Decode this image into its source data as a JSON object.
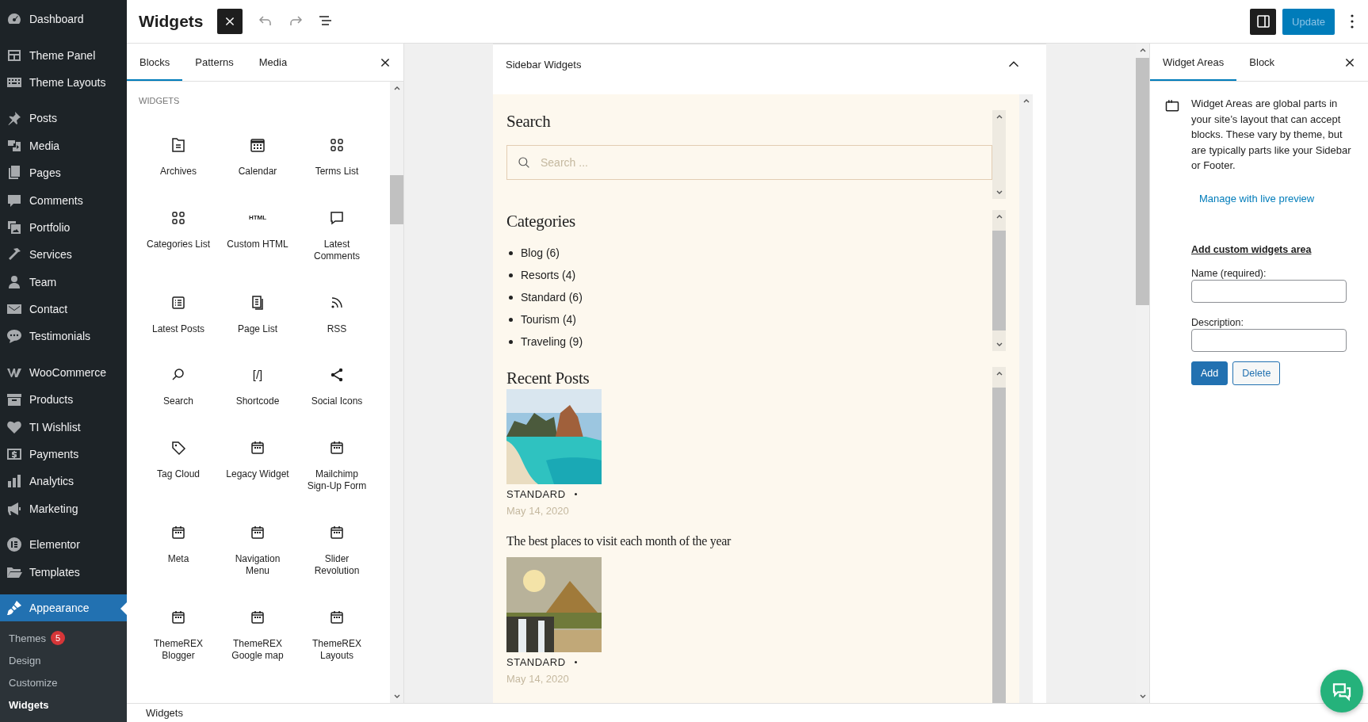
{
  "admin_menu": {
    "groups": [
      [
        {
          "label": "Dashboard",
          "kind": "dashboard",
          "selected": false
        }
      ],
      [
        {
          "label": "Theme Panel",
          "kind": "panel",
          "selected": false
        },
        {
          "label": "Theme Layouts",
          "kind": "layouts",
          "selected": false
        }
      ],
      [
        {
          "label": "Posts",
          "kind": "pin",
          "selected": false
        },
        {
          "label": "Media",
          "kind": "media",
          "selected": false
        },
        {
          "label": "Pages",
          "kind": "pages",
          "selected": false
        },
        {
          "label": "Comments",
          "kind": "comment",
          "selected": false
        },
        {
          "label": "Portfolio",
          "kind": "portfolio",
          "selected": false
        },
        {
          "label": "Services",
          "kind": "hammer",
          "selected": false
        },
        {
          "label": "Team",
          "kind": "person",
          "selected": false
        },
        {
          "label": "Contact",
          "kind": "mail",
          "selected": false
        },
        {
          "label": "Testimonials",
          "kind": "chat",
          "selected": false
        }
      ],
      [
        {
          "label": "WooCommerce",
          "kind": "woo",
          "selected": false
        },
        {
          "label": "Products",
          "kind": "box",
          "selected": false
        },
        {
          "label": "TI Wishlist",
          "kind": "heart",
          "selected": false
        },
        {
          "label": "Payments",
          "kind": "dollar",
          "selected": false
        },
        {
          "label": "Analytics",
          "kind": "bars",
          "selected": false
        },
        {
          "label": "Marketing",
          "kind": "megaphone",
          "selected": false
        }
      ],
      [
        {
          "label": "Elementor",
          "kind": "elementor",
          "selected": false
        },
        {
          "label": "Templates",
          "kind": "folder",
          "selected": false
        }
      ],
      [
        {
          "label": "Appearance",
          "kind": "brush",
          "selected": true
        }
      ]
    ],
    "submenu": [
      {
        "label": "Themes",
        "badge": "5",
        "selected": false
      },
      {
        "label": "Design",
        "selected": false
      },
      {
        "label": "Customize",
        "selected": false
      },
      {
        "label": "Widgets",
        "selected": true
      }
    ]
  },
  "header": {
    "title": "Widgets",
    "update": {
      "label": "Update",
      "disabled": true
    }
  },
  "inserter": {
    "tabs": [
      {
        "label": "Blocks",
        "selected": true
      },
      {
        "label": "Patterns",
        "selected": false
      },
      {
        "label": "Media",
        "selected": false
      }
    ],
    "section_title": "WIDGETS",
    "blocks": [
      {
        "label": "Archives",
        "kind": "archive"
      },
      {
        "label": "Calendar",
        "kind": "calendar"
      },
      {
        "label": "Terms List",
        "kind": "grid"
      },
      {
        "label": "Categories List",
        "kind": "grid"
      },
      {
        "label": "Custom HTML",
        "kind": "html",
        "icon_text": "HTML"
      },
      {
        "label": "Latest Comments",
        "kind": "comment"
      },
      {
        "label": "Latest Posts",
        "kind": "list"
      },
      {
        "label": "Page List",
        "kind": "pages"
      },
      {
        "label": "RSS",
        "kind": "rss"
      },
      {
        "label": "Search",
        "kind": "search"
      },
      {
        "label": "Shortcode",
        "kind": "shortcode",
        "icon_text": "[/]"
      },
      {
        "label": "Social Icons",
        "kind": "share"
      },
      {
        "label": "Tag Cloud",
        "kind": "tag"
      },
      {
        "label": "Legacy Widget",
        "kind": "widget"
      },
      {
        "label": "Mailchimp Sign-Up Form",
        "kind": "widget"
      },
      {
        "label": "Meta",
        "kind": "widget"
      },
      {
        "label": "Navigation Menu",
        "kind": "widget"
      },
      {
        "label": "Slider Revolution",
        "kind": "widget"
      },
      {
        "label": "ThemeREX Blogger",
        "kind": "widget"
      },
      {
        "label": "ThemeREX Google map",
        "kind": "widget"
      },
      {
        "label": "ThemeREX Layouts",
        "kind": "widget"
      }
    ]
  },
  "canvas": {
    "area_title": "Sidebar Widgets",
    "expanded": true,
    "search": {
      "title": "Search",
      "placeholder": "Search ..."
    },
    "categories": {
      "title": "Categories",
      "items": [
        "Blog (6)",
        "Resorts (4)",
        "Standard (6)",
        "Tourism (4)",
        "Traveling (9)"
      ]
    },
    "recent_posts": {
      "title": "Recent Posts",
      "posts": [
        {
          "category": "STANDARD",
          "date": "May 14, 2020"
        },
        {
          "title": "The best places to visit each month of the year",
          "category": "STANDARD",
          "date": "May 14, 2020"
        }
      ]
    }
  },
  "settings": {
    "tabs": [
      {
        "label": "Widget Areas",
        "selected": true
      },
      {
        "label": "Block",
        "selected": false
      }
    ],
    "description": "Widget Areas are global parts in your site’s layout that can accept blocks. These vary by theme, but are typically parts like your Sidebar or Footer.",
    "link": "Manage with live preview",
    "form": {
      "heading": "Add custom widgets area",
      "fields": [
        {
          "label": "Name (required):"
        },
        {
          "label": "Description:"
        }
      ],
      "buttons": [
        {
          "label": "Add",
          "kind": "primary"
        },
        {
          "label": "Delete",
          "kind": "secondary"
        }
      ]
    }
  },
  "breadcrumb": "Widgets"
}
